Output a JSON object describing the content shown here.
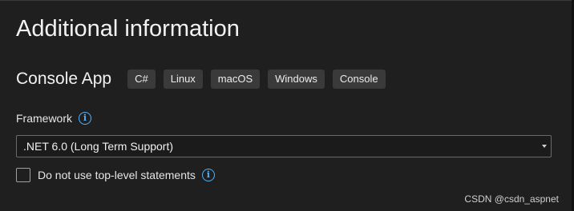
{
  "page": {
    "title": "Additional information"
  },
  "template": {
    "name": "Console App",
    "tags": [
      "C#",
      "Linux",
      "macOS",
      "Windows",
      "Console"
    ]
  },
  "framework": {
    "label": "Framework",
    "info_icon": "info-icon",
    "selected": ".NET 6.0 (Long Term Support)",
    "dropdown_icon": "chevron-down-icon"
  },
  "options": {
    "top_level_statements": {
      "label": "Do not use top-level statements",
      "checked": false,
      "info_icon": "info-icon"
    }
  },
  "watermark": "CSDN @csdn_aspnet",
  "colors": {
    "background": "#1f1f1f",
    "tag_background": "#3a3a3a",
    "accent_info": "#4fb3ff",
    "border": "#6a6a6a"
  }
}
